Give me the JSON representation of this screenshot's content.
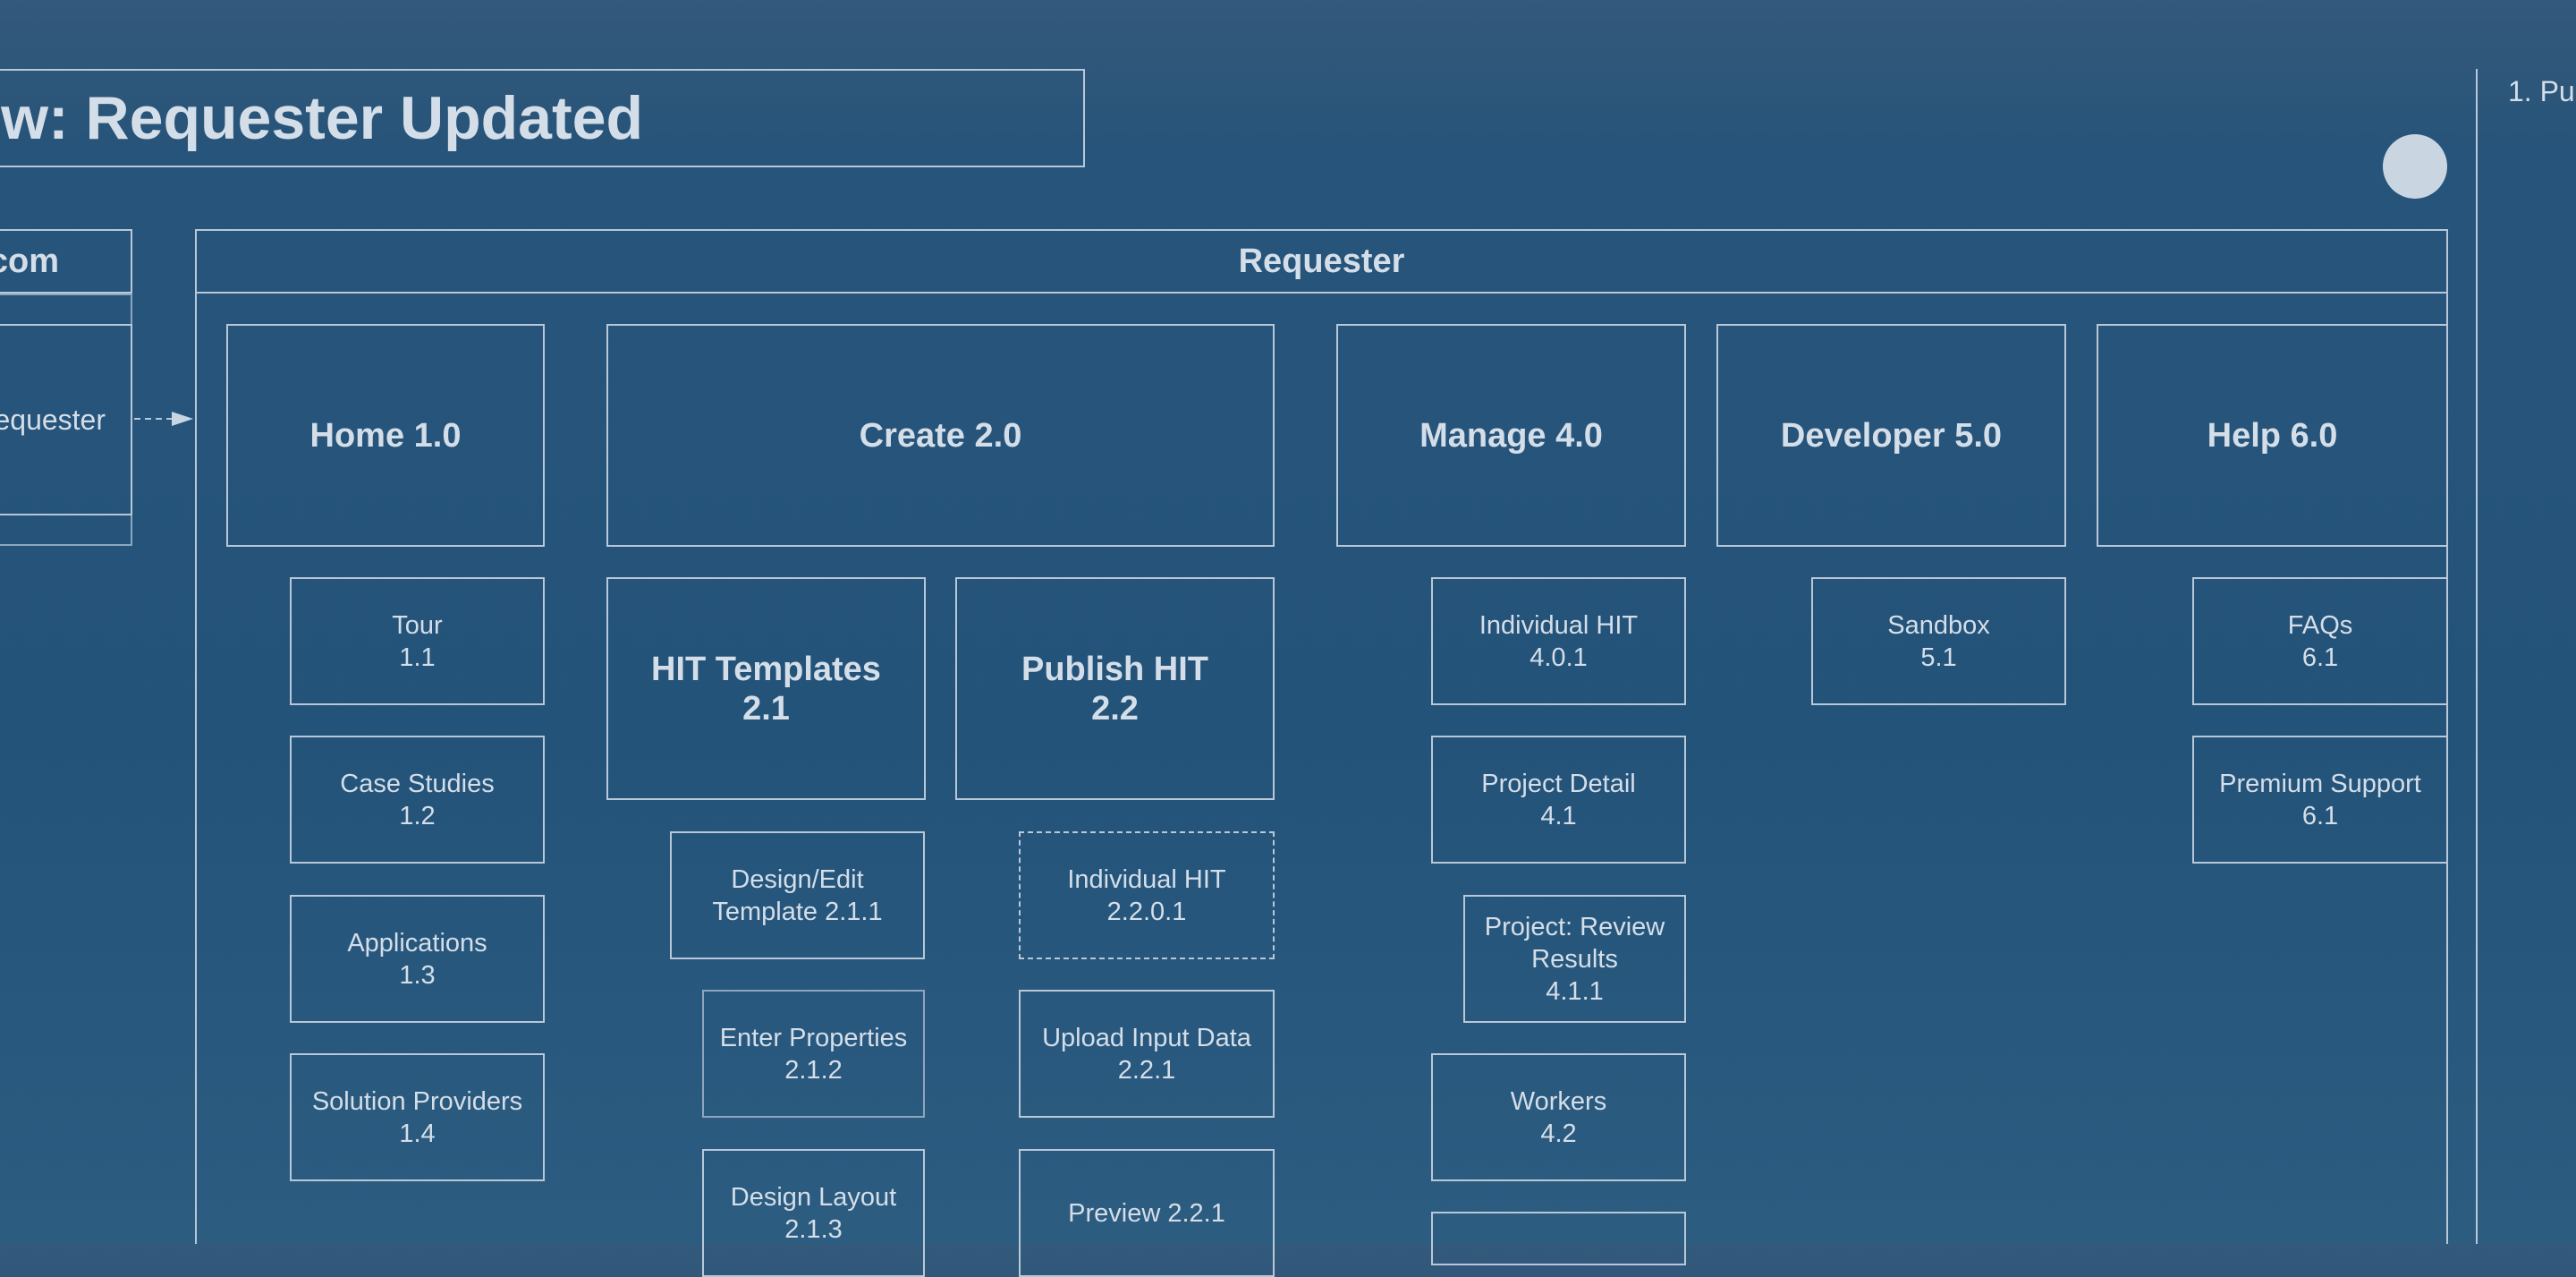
{
  "title": "w: Requester Updated",
  "side_note": "1. Pu",
  "left_panel": {
    "header": "com",
    "item": "equester"
  },
  "requester": {
    "header": "Requester"
  },
  "sections": {
    "home": "Home 1.0",
    "create": "Create 2.0",
    "manage": "Manage 4.0",
    "developer": "Developer 5.0",
    "help": "Help 6.0"
  },
  "subsections": {
    "hit_templates": {
      "name": "HIT Templates",
      "num": "2.1"
    },
    "publish_hit": {
      "name": "Publish HIT",
      "num": "2.2"
    }
  },
  "home_items": [
    {
      "name": "Tour",
      "num": "1.1"
    },
    {
      "name": "Case Studies",
      "num": "1.2"
    },
    {
      "name": "Applications",
      "num": "1.3"
    },
    {
      "name": "Solution Providers",
      "num": "1.4"
    }
  ],
  "template_items": [
    {
      "name": "Design/Edit",
      "num": "Template 2.1.1"
    },
    {
      "name": "Enter Properties",
      "num": "2.1.2"
    },
    {
      "name": "Design Layout",
      "num": "2.1.3"
    }
  ],
  "publish_items": [
    {
      "name": "Individual HIT",
      "num": "2.2.0.1"
    },
    {
      "name": "Upload Input Data",
      "num": "2.2.1"
    },
    {
      "name": "Preview 2.2.1"
    }
  ],
  "manage_items": [
    {
      "name": "Individual HIT",
      "num": "4.0.1"
    },
    {
      "name": "Project Detail",
      "num": "4.1"
    },
    {
      "name": "Project: Review",
      "name2": "Results",
      "num": "4.1.1"
    },
    {
      "name": "Workers",
      "num": "4.2"
    }
  ],
  "developer_items": [
    {
      "name": "Sandbox",
      "num": "5.1"
    }
  ],
  "help_items": [
    {
      "name": "FAQs",
      "num": "6.1"
    },
    {
      "name": "Premium Support",
      "num": "6.1"
    }
  ],
  "colors": {
    "background": "#27547a",
    "stroke": "#b8c8d8",
    "text": "#d4dee8",
    "marker": "#c9d6e2"
  }
}
